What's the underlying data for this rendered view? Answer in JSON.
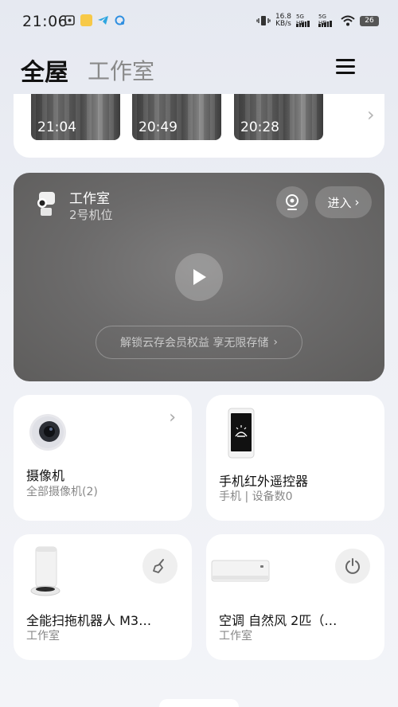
{
  "status_bar": {
    "time": "21:06",
    "net_speed_value": "16.8",
    "net_speed_unit": "KB/s",
    "sim1_label": "5G HD",
    "sim2_label": "5G HD",
    "battery": "26",
    "icons": [
      "mi-home-icon",
      "meituan-icon",
      "telegram-icon",
      "ai-assistant-icon",
      "vibrate-icon",
      "wifi-icon"
    ]
  },
  "header": {
    "tabs": [
      {
        "label": "全屋",
        "active": true
      },
      {
        "label": "工作室",
        "active": false
      }
    ],
    "menu_icon": "hamburger-menu-icon"
  },
  "thumbnails": [
    {
      "time": "21:04"
    },
    {
      "time": "20:49"
    },
    {
      "time": "20:28"
    }
  ],
  "camera_card": {
    "title": "工作室",
    "subtitle": "2号机位",
    "enter_label": "进入",
    "unlock_label": "解锁云存会员权益 享无限存储",
    "icons": [
      "camera-device-icon",
      "camera-record-icon",
      "play-icon",
      "chevron-right-icon"
    ]
  },
  "devices": [
    {
      "name": "摄像机",
      "sub": "全部摄像机(2)",
      "icon": "camera-icon"
    },
    {
      "name": "手机红外遥控器",
      "sub": "手机 | 设备数0",
      "icon": "phone-ir-icon"
    },
    {
      "name": "全能扫拖机器人 M3…",
      "sub": "工作室",
      "icon": "robot-vacuum-icon",
      "action_icon": "sweep-icon"
    },
    {
      "name": "空调 自然风 2匹（…",
      "sub": "工作室",
      "icon": "air-conditioner-icon",
      "action_icon": "power-icon"
    }
  ],
  "colors": {
    "background": "#eef0f5",
    "card": "#ffffff",
    "camera_panel": "#6b6a6a",
    "active_tab": "#111111",
    "inactive_tab": "#8a8a8a"
  }
}
